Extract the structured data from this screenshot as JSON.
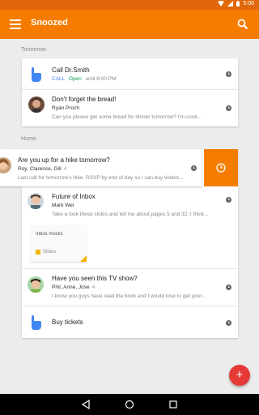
{
  "status_bar": {
    "time": "5:00"
  },
  "app_bar": {
    "title": "Snoozed"
  },
  "sections": {
    "tomorrow": "Tomorrow",
    "home": "Home"
  },
  "items": {
    "call": {
      "title": "Call Dr.Smith",
      "action_call": "CALL",
      "status_open": "Open",
      "status_until": "until 8:00 PM"
    },
    "bread": {
      "title": "Don't forget the bread!",
      "sender": "Ryan Proch",
      "snippet": "Can you please get some bread for dinner tomorrow? I'm cook..."
    },
    "hike": {
      "title": "Are you up for a hike tomorrow?",
      "senders": "Roy, Clarence, Gill",
      "count": "4",
      "snippet": "Last call for tomorrow's hike. RSVP by end of day so I can buy tickets..."
    },
    "inbox": {
      "title": "Future of Inbox",
      "sender": "Mark Wei",
      "snippet": "Take a look these slides and tell me about pages 5 and 32. I think...",
      "attachment_name": "Inbox mocks",
      "attachment_type": "Slides"
    },
    "tv": {
      "title": "Have you seen this TV show?",
      "senders": "Phil, Anne, Jose",
      "count": "4",
      "snippet": "I know you guys have read the book and I would love to get your..."
    },
    "tickets": {
      "title": "Buy tickets"
    }
  },
  "fab": {
    "label": "+"
  },
  "colors": {
    "primary": "#f57c00",
    "status_bar": "#e0680a",
    "fab": "#e53935",
    "open_green": "#0f9d58",
    "call_blue": "#4285f4"
  },
  "icons": [
    "menu-icon",
    "search-icon",
    "clock-icon",
    "reminder-hand-icon",
    "wifi-icon",
    "signal-icon",
    "battery-icon",
    "back-icon",
    "home-icon",
    "recents-icon"
  ]
}
